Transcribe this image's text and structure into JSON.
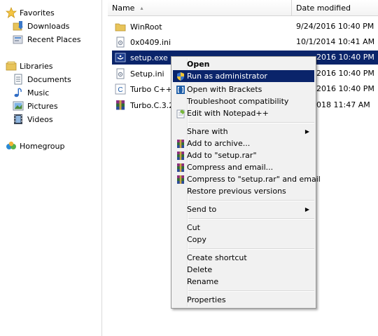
{
  "columns": {
    "name": "Name",
    "date_modified": "Date modified",
    "sort_arrow": "▴"
  },
  "nav": {
    "favorites": "Favorites",
    "downloads": "Downloads",
    "recent_places": "Recent Places",
    "libraries": "Libraries",
    "documents": "Documents",
    "music": "Music",
    "pictures": "Pictures",
    "videos": "Videos",
    "homegroup": "Homegroup"
  },
  "files": [
    {
      "name": "WinRoot",
      "date": "9/24/2016 10:40 PM",
      "icon": "folder-icon"
    },
    {
      "name": "0x0409.ini",
      "date": "10/1/2014 10:41 AM",
      "icon": "ini-file-icon"
    },
    {
      "name": "setup.exe",
      "date": "2016 10:40 PM",
      "icon": "setup-exe-icon",
      "selected": true
    },
    {
      "name": "Setup.ini",
      "date": "2016 10:40 PM",
      "icon": "ini-file-icon"
    },
    {
      "name": "Turbo C++",
      "date": "2016 10:40 PM",
      "icon": "turbo-shortcut-icon"
    },
    {
      "name": "Turbo.C.3.2",
      "date": "018 11:47 AM",
      "icon": "rar-archive-icon"
    }
  ],
  "context_menu": {
    "open": "Open",
    "run_as_admin": "Run as administrator",
    "open_with_brackets": "Open with Brackets",
    "troubleshoot": "Troubleshoot compatibility",
    "edit_notepadpp": "Edit with Notepad++",
    "share_with": "Share with",
    "add_to_archive": "Add to archive...",
    "add_to_rar": "Add to \"setup.rar\"",
    "compress_email": "Compress and email...",
    "compress_rar_email": "Compress to \"setup.rar\" and email",
    "restore_versions": "Restore previous versions",
    "send_to": "Send to",
    "cut": "Cut",
    "copy": "Copy",
    "create_shortcut": "Create shortcut",
    "delete": "Delete",
    "rename": "Rename",
    "properties": "Properties",
    "submenu_arrow": "▶"
  },
  "colors": {
    "selection": "#0a246a",
    "menu_bg": "#f1f1f1"
  }
}
